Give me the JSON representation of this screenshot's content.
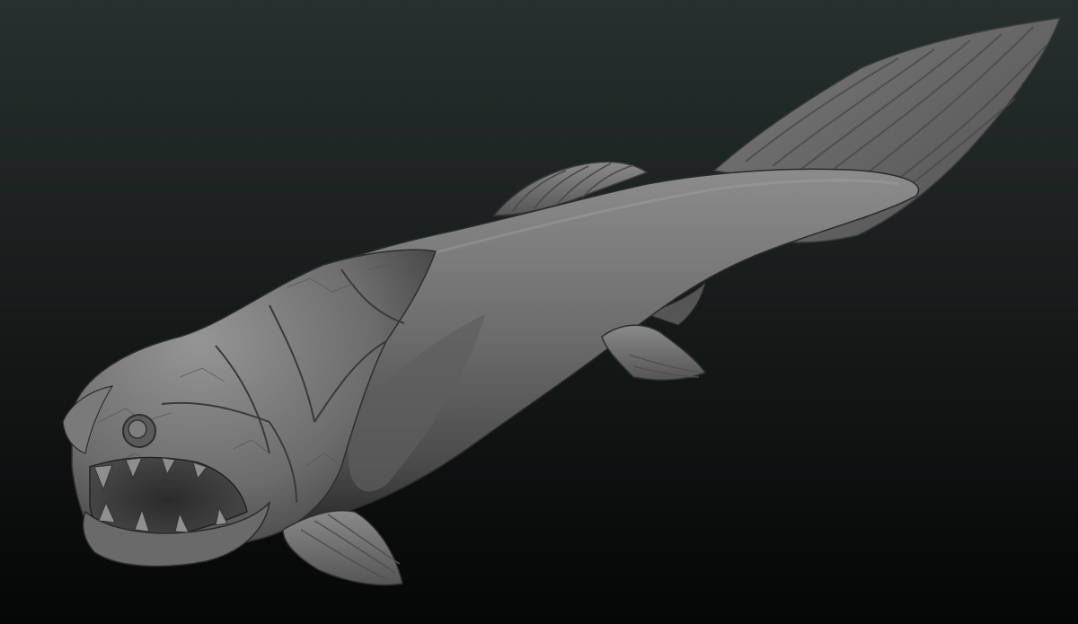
{
  "scene": {
    "subject_icon": "dunkleosteus-sculpt-icon",
    "colors": {
      "background_top": "#27302f",
      "background_bottom": "#050606",
      "clay_light": "#8c8c8c",
      "clay_mid": "#6a6a6a",
      "clay_dark": "#3d3d3d",
      "clay_shadow": "#222222"
    }
  }
}
